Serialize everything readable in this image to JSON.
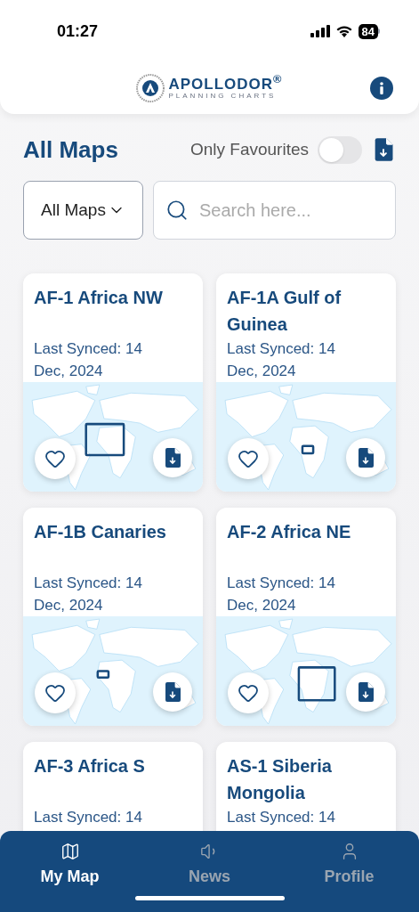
{
  "status_bar": {
    "time": "01:27",
    "battery": "84"
  },
  "header": {
    "logo_name": "APOLLODOR$^{®}$",
    "logo_tagline": "PLANNING CHARTS"
  },
  "title": "All Maps",
  "favourites_toggle": {
    "label": "Only Favourites",
    "on": false
  },
  "filter": {
    "value": "All Maps"
  },
  "search": {
    "placeholder": "Search here..."
  },
  "maps": [
    {
      "title": "AF-1 Africa NW",
      "synced": "Last Synced: 14 Dec, 2024",
      "favorite": false
    },
    {
      "title": "AF-1A Gulf of Guinea",
      "synced": "Last Synced: 14 Dec, 2024",
      "favorite": false
    },
    {
      "title": "AF-1B Canaries",
      "synced": "Last Synced: 14 Dec, 2024",
      "favorite": false
    },
    {
      "title": "AF-2 Africa NE",
      "synced": "Last Synced: 14 Dec, 2024",
      "favorite": false
    },
    {
      "title": "AF-3 Africa S",
      "synced": "Last Synced: 14"
    },
    {
      "title": "AS-1 Siberia Mongolia",
      "synced": "Last Synced: 14"
    }
  ],
  "nav": [
    {
      "label": "My Map",
      "kind": "map",
      "selected": true
    },
    {
      "label": "News",
      "kind": "news",
      "selected": false
    },
    {
      "label": "Profile",
      "kind": "profile",
      "selected": false
    }
  ]
}
